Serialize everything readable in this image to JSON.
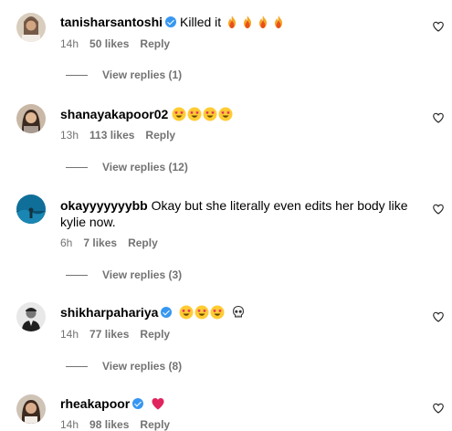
{
  "comments": [
    {
      "username": "tanisharsantoshi",
      "verified": true,
      "text": "Killed it",
      "emojis": [
        "fire-emoji",
        "fire-emoji",
        "fire-emoji",
        "fire-emoji"
      ],
      "time": "14h",
      "likes": "50 likes",
      "reply": "Reply",
      "view_replies": "View replies (1)"
    },
    {
      "username": "shanayakapoor02",
      "verified": false,
      "text": "",
      "emojis": [
        "star-struck-emoji",
        "star-struck-emoji",
        "star-struck-emoji",
        "star-struck-emoji"
      ],
      "time": "13h",
      "likes": "113 likes",
      "reply": "Reply",
      "view_replies": "View replies (12)"
    },
    {
      "username": "okayyyyyyybb",
      "verified": false,
      "text": "Okay but she literally even edits her body like kylie now.",
      "emojis": [],
      "time": "6h",
      "likes": "7 likes",
      "reply": "Reply",
      "view_replies": "View replies (3)"
    },
    {
      "username": "shikharpahariya",
      "verified": true,
      "text": "",
      "emojis": [
        "star-struck-emoji",
        "star-struck-emoji",
        "star-struck-emoji",
        "skull-emoji"
      ],
      "time": "14h",
      "likes": "77 likes",
      "reply": "Reply",
      "view_replies": "View replies (8)"
    },
    {
      "username": "rheakapoor",
      "verified": true,
      "text": "",
      "emojis": [
        "red-heart-emoji"
      ],
      "time": "14h",
      "likes": "98 likes",
      "reply": "Reply",
      "view_replies": ""
    }
  ],
  "colors": {
    "secondary_text": "#737373",
    "verified_blue": "#3797f0",
    "fire": "#f77f00",
    "emoji_yellow": "#ffcc33",
    "heart_red": "#e0245e"
  },
  "icons": {
    "like": "heart-outline-icon"
  }
}
